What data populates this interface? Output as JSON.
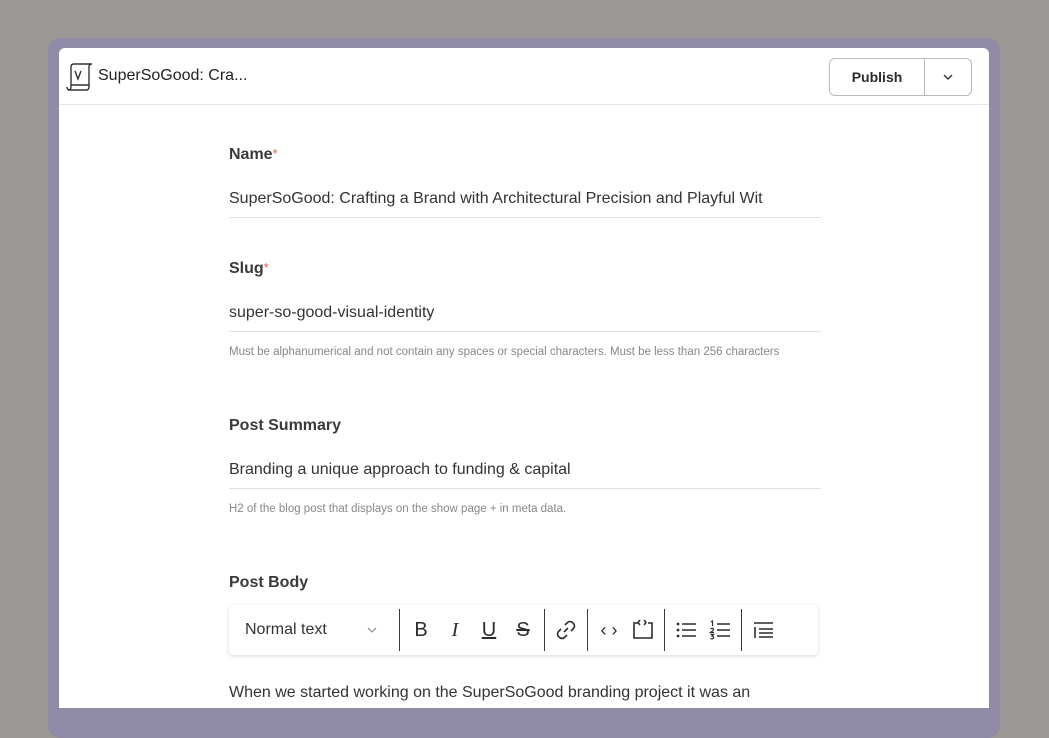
{
  "header": {
    "title": "SuperSoGood: Cra...",
    "publish_label": "Publish"
  },
  "fields": {
    "name": {
      "label": "Name",
      "required_mark": "*",
      "value": "SuperSoGood: Crafting a Brand with Architectural Precision and Playful Wit"
    },
    "slug": {
      "label": "Slug",
      "required_mark": "*",
      "value": "super-so-good-visual-identity",
      "hint": "Must be alphanumerical and not contain any spaces or special characters. Must be less than 256 characters"
    },
    "summary": {
      "label": "Post Summary",
      "value": "Branding a unique approach to funding & capital",
      "hint": "H2 of the blog post that displays on the show page + in meta data."
    },
    "body": {
      "label": "Post Body",
      "text_style": "Normal text",
      "content_preview": "When we started working on the SuperSoGood branding project it was an"
    }
  },
  "icons": {
    "bold": "B",
    "italic": "I",
    "underline": "U",
    "strike": "S",
    "code": "‹ ›"
  },
  "colors": {
    "required": "#e25c4d",
    "frame": "#8f8aa6",
    "background": "#9c9896"
  }
}
